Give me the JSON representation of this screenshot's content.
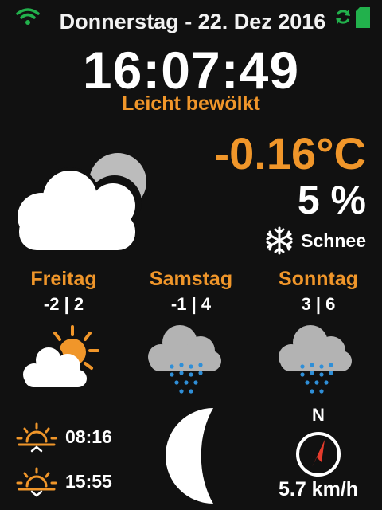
{
  "header": {
    "date": "Donnerstag - 22. Dez 2016",
    "wifi_icon": "wifi-icon",
    "sync_icon": "sync-icon",
    "battery_icon": "sd-card-icon"
  },
  "current": {
    "time": "16:07:49",
    "condition": "Leicht bewölkt",
    "temperature": "-0.16°C",
    "humidity": "5 %",
    "precipitation": "Schnee",
    "icon": "cloud-moon-icon",
    "precip_icon": "snowflake-icon"
  },
  "forecast": [
    {
      "day": "Freitag",
      "temps": "-2 | 2",
      "icon": "partly-cloudy-sun-icon"
    },
    {
      "day": "Samstag",
      "temps": "-1 | 4",
      "icon": "rain-cloud-icon"
    },
    {
      "day": "Sonntag",
      "temps": "3 | 6",
      "icon": "rain-cloud-icon"
    }
  ],
  "sun": {
    "sunrise": "08:16",
    "sunset": "15:55"
  },
  "moon": {
    "icon": "moon-phase-icon"
  },
  "wind": {
    "direction": "N",
    "speed": "5.7 km/h",
    "icon": "compass-arrow-icon"
  },
  "colors": {
    "background": "#111111",
    "accent": "#f0962a",
    "status_green": "#22b14c",
    "text": "#ffffff"
  }
}
